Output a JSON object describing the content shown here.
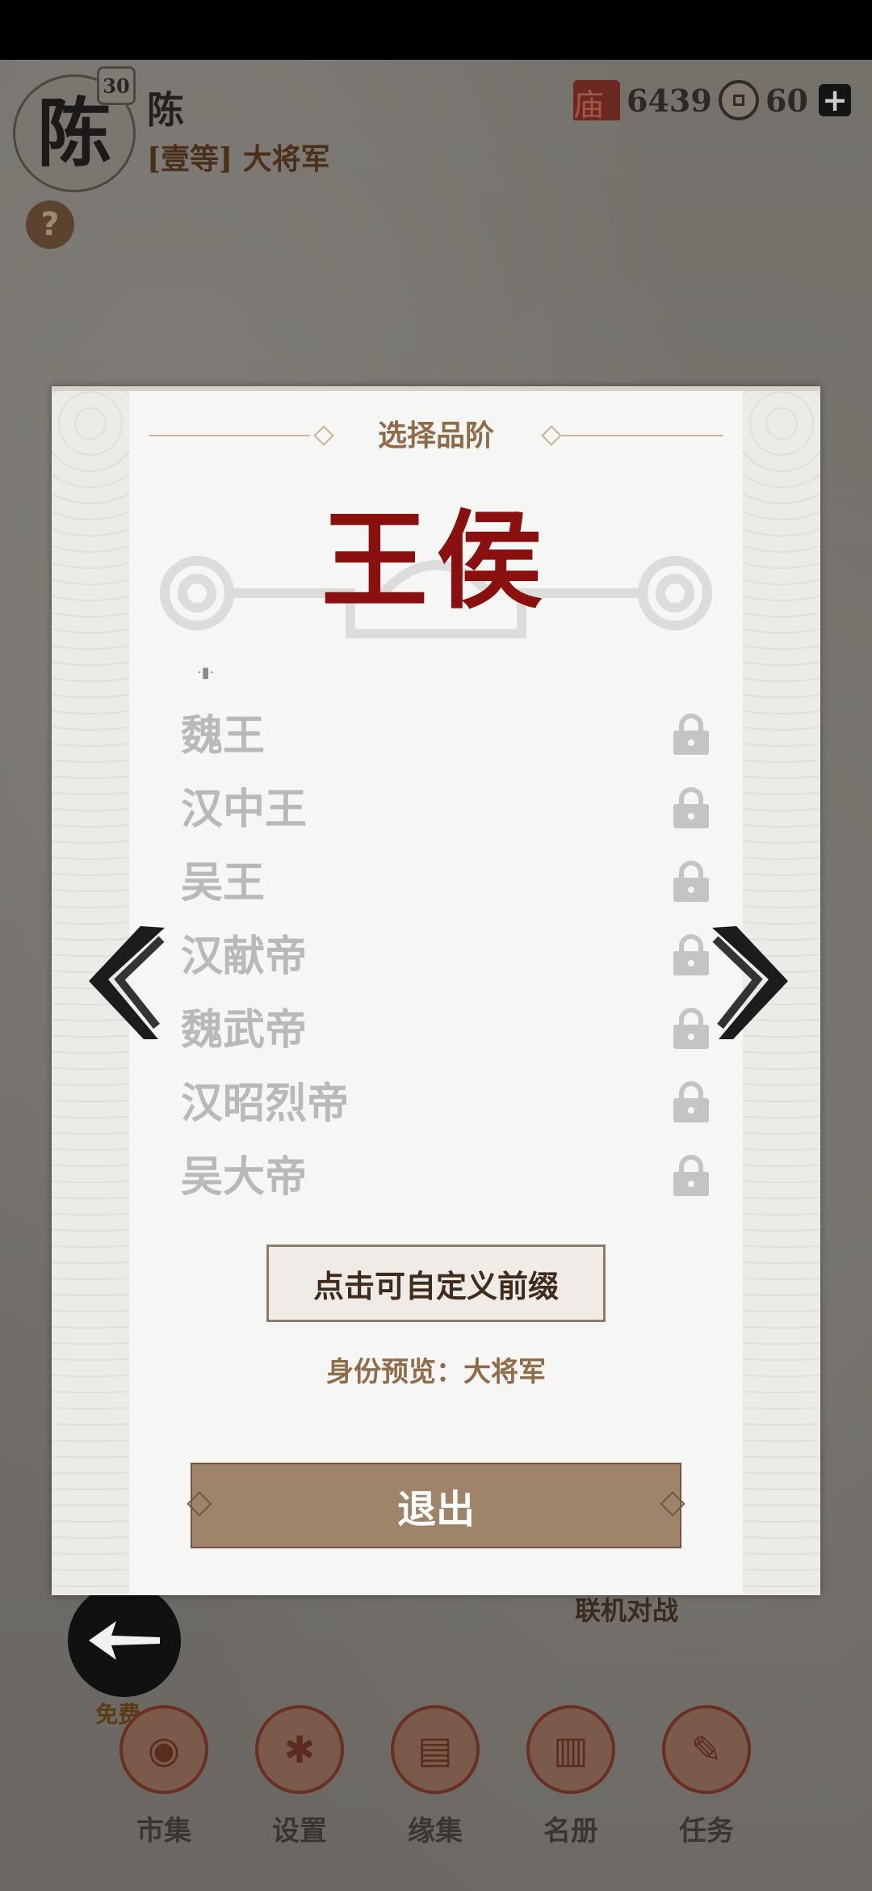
{
  "player": {
    "avatar_char": "陈",
    "level": "30",
    "name": "陈",
    "rank": "[壹等] 大将军"
  },
  "resources": {
    "hall_icon": "hall-icon",
    "hall_value": "6439",
    "coin_icon": "coin-icon",
    "coin_value": "60"
  },
  "background": {
    "online_label": "联机对战",
    "free_label": "免费"
  },
  "nav": [
    {
      "label": "市集",
      "icon": "market-icon"
    },
    {
      "label": "设置",
      "icon": "settings-icon"
    },
    {
      "label": "缘集",
      "icon": "book-icon"
    },
    {
      "label": "名册",
      "icon": "roster-icon"
    },
    {
      "label": "任务",
      "icon": "task-icon"
    }
  ],
  "dialog": {
    "title": "选择品阶",
    "rank_category": "王侯",
    "tiny_label": "·▮·",
    "ranks": [
      {
        "name": "魏王",
        "locked": true
      },
      {
        "name": "汉中王",
        "locked": true
      },
      {
        "name": "吴王",
        "locked": true
      },
      {
        "name": "汉献帝",
        "locked": true
      },
      {
        "name": "魏武帝",
        "locked": true
      },
      {
        "name": "汉昭烈帝",
        "locked": true
      },
      {
        "name": "吴大帝",
        "locked": true
      }
    ],
    "custom_button": "点击可自定义前缀",
    "preview_label": "身份预览：",
    "preview_value": "大将军",
    "exit_button": "退出"
  },
  "colors": {
    "accent_red": "#8a1010",
    "brown": "#a0846a",
    "locked_text": "#b9b9b9"
  }
}
